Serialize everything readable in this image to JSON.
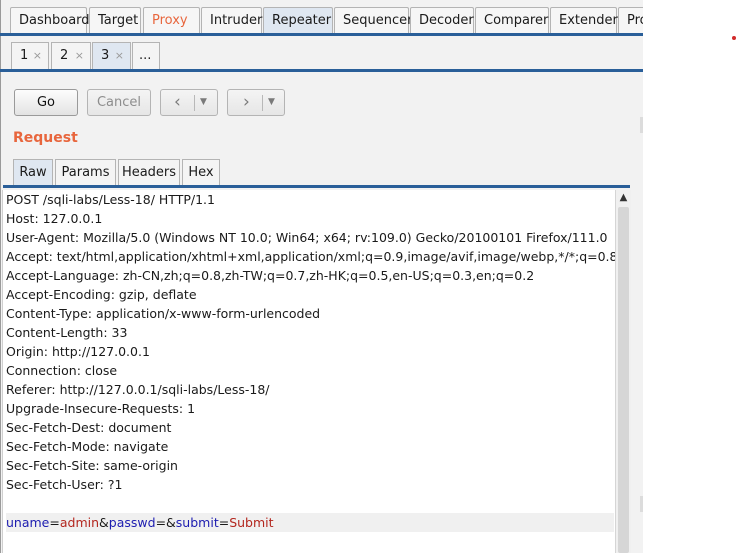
{
  "main_tabs": [
    {
      "label": "Dashboard"
    },
    {
      "label": "Target"
    },
    {
      "label": "Proxy"
    },
    {
      "label": "Intruder"
    },
    {
      "label": "Repeater"
    },
    {
      "label": "Sequencer"
    },
    {
      "label": "Decoder"
    },
    {
      "label": "Comparer"
    },
    {
      "label": "Extender"
    },
    {
      "label": "Proje"
    }
  ],
  "active_main_tab": "Repeater",
  "sub_tabs": [
    {
      "label": "1",
      "close": "×"
    },
    {
      "label": "2",
      "close": "×"
    },
    {
      "label": "3",
      "close": "×"
    },
    {
      "label": "..."
    }
  ],
  "active_sub_tab": "3",
  "toolbar": {
    "go_label": "Go",
    "cancel_label": "Cancel",
    "back_icon": "‹",
    "forward_icon": "›",
    "dropdown_icon": "▼"
  },
  "request": {
    "title": "Request",
    "tabs": [
      {
        "label": "Raw"
      },
      {
        "label": "Params"
      },
      {
        "label": "Headers"
      },
      {
        "label": "Hex"
      }
    ],
    "active_tab": "Raw",
    "lines": [
      "POST /sqli-labs/Less-18/ HTTP/1.1",
      "Host: 127.0.0.1",
      "User-Agent: Mozilla/5.0 (Windows NT 10.0; Win64; x64; rv:109.0) Gecko/20100101 Firefox/111.0",
      "Accept: text/html,application/xhtml+xml,application/xml;q=0.9,image/avif,image/webp,*/*;q=0.8",
      "Accept-Language: zh-CN,zh;q=0.8,zh-TW;q=0.7,zh-HK;q=0.5,en-US;q=0.3,en;q=0.2",
      "Accept-Encoding: gzip, deflate",
      "Content-Type: application/x-www-form-urlencoded",
      "Content-Length: 33",
      "Origin: http://127.0.0.1",
      "Connection: close",
      "Referer: http://127.0.0.1/sqli-labs/Less-18/",
      "Upgrade-Insecure-Requests: 1",
      "Sec-Fetch-Dest: document",
      "Sec-Fetch-Mode: navigate",
      "Sec-Fetch-Site: same-origin",
      "Sec-Fetch-User: ?1",
      ""
    ],
    "body_params": {
      "p1_name": "uname",
      "p1_value": "admin",
      "p2_name": "passwd",
      "p2_value": "",
      "p3_name": "submit",
      "p3_value": "Submit",
      "eq": "=",
      "amp": "&"
    }
  },
  "scrollbar": {
    "up_icon": "▲"
  },
  "colors": {
    "accent_orange": "#e8663d",
    "tab_underline_blue": "#2a5f99",
    "param_name": "#1c1cb0",
    "param_value": "#b3261e"
  }
}
